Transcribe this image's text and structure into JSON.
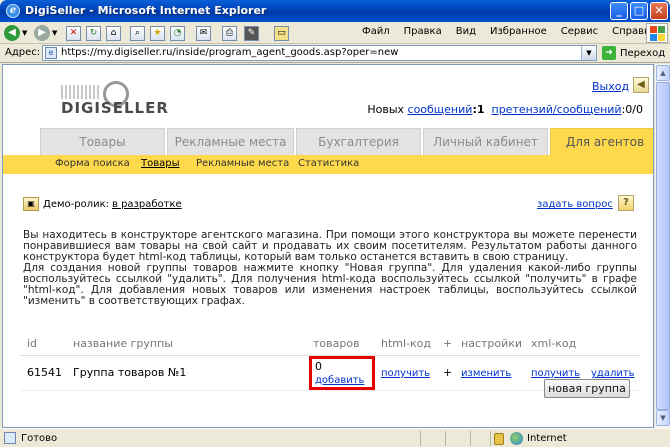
{
  "window": {
    "title": "DigiSeller - Microsoft Internet Explorer",
    "controls": [
      "_",
      "□",
      "✕"
    ]
  },
  "menubar": [
    "Файл",
    "Правка",
    "Вид",
    "Избранное",
    "Сервис",
    "Справка"
  ],
  "toolbar_icons": [
    "back-icon",
    "forward-icon",
    "stop-icon",
    "refresh-icon",
    "home-icon",
    "search-icon",
    "favorites-icon",
    "history-icon",
    "mail-icon",
    "print-icon",
    "edit-icon",
    "folder-icon"
  ],
  "address": {
    "label": "Адрес:",
    "url": "https://my.digiseller.ru/inside/program_agent_goods.asp?oper=new",
    "go_label": "Переход"
  },
  "header": {
    "logo_text": "DIGISELLER",
    "exit_label": "Выход",
    "notif_prefix": "Новых",
    "messages_link": "сообщений",
    "messages_count": ":1",
    "claims_link": "претензий/сообщений",
    "claims_count": ":0/0"
  },
  "tabs": [
    {
      "label": "Товары",
      "active": false
    },
    {
      "label": "Рекламные места",
      "active": false
    },
    {
      "label": "Бухгалтерия",
      "active": false
    },
    {
      "label": "Личный кабинет",
      "active": false
    },
    {
      "label": "Для агентов",
      "active": true
    }
  ],
  "subnav": [
    {
      "label": "Форма поиска",
      "active": false
    },
    {
      "label": "Товары",
      "active": true
    },
    {
      "label": "Рекламные места",
      "active": false
    },
    {
      "label": "Статистика",
      "active": false
    }
  ],
  "demo": {
    "label": "Демо-ролик:",
    "link": "в разработке"
  },
  "ask_label": "задать вопрос",
  "description": [
    "Вы находитесь в конструкторе агентского магазина. При помощи этого конструктора вы можете перенести понравившиеся вам товары на свой сайт и продавать их своим посетителям. Результатом работы данного конструктора будет html-код таблицы, который вам только останется вставить в свою страницу.",
    "Для создания новой группы товаров нажмите кнопку \"Новая группа\". Для удаления какой-либо группы воспользуйтесь ссылкой \"удалить\". Для получения html-кода воспользуйтесь ссылкой \"получить\" в графе \"html-код\". Для добавления новых товаров или изменения настроек таблицы, воспользуйтесь ссылкой \"изменить\" в соответствующих графах."
  ],
  "table": {
    "headers": [
      "id",
      "название группы",
      "товаров",
      "html-код",
      "+",
      "настройки",
      "xml-код",
      ""
    ],
    "rows": [
      {
        "id": "61541",
        "name": "Группа товаров №1",
        "goods_count": "0",
        "add_label": "добавить",
        "get_html": "получить",
        "plus": "+",
        "change_label": "изменить",
        "get_xml": "получить",
        "delete_label": "удалить"
      }
    ]
  },
  "new_group_button": "новая группа",
  "status": {
    "ready": "Готово",
    "zone": "Internet"
  },
  "colors": {
    "tab_active": "#fdd94b",
    "link": "#0033cc",
    "highlight": "#e60000"
  }
}
